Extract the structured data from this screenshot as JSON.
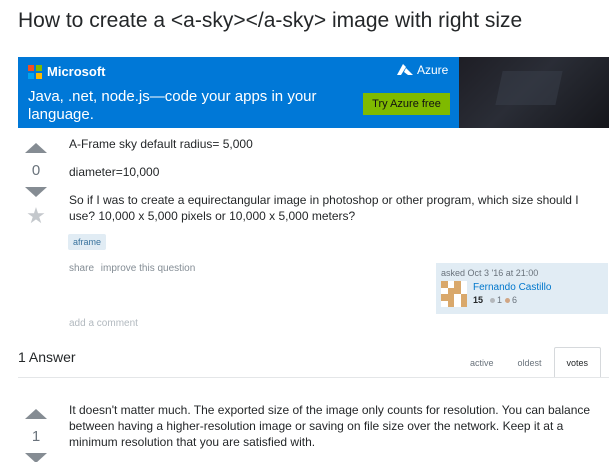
{
  "question": {
    "title": "How to create a <a-sky></a-sky> image with right size",
    "votes": "0",
    "body": [
      "A-Frame sky default radius= 5,000",
      "diameter=10,000",
      "So if I was to create a equirectangular image in photoshop or other program, which size should I use? 10,000 x 5,000 pixels or 10,000 x 5,000 meters?"
    ],
    "tag": "aframe",
    "share_label": "share",
    "improve_label": "improve this question",
    "add_comment_label": "add a comment",
    "asked": "asked Oct 3 '16 at 21:00",
    "user": {
      "name": "Fernando Castillo",
      "reputation": "15",
      "silver": "1",
      "bronze": "6"
    }
  },
  "ad": {
    "brand": "Microsoft",
    "tagline": "Java, .net, node.js—code your apps in your language.",
    "azure_label": "Azure",
    "cta": "Try Azure free",
    "colors": {
      "background": "#0078d7",
      "cta": "#7fba00"
    }
  },
  "answers": {
    "header": "1 Answer",
    "sort_tabs": [
      "active",
      "oldest",
      "votes"
    ],
    "selected_tab": "votes",
    "items": [
      {
        "votes": "1",
        "body": "It doesn't matter much. The exported size of the image only counts for resolution. You can balance between having a higher-resolution image or saving on file size over the network. Keep it at a minimum resolution that you are satisfied with."
      }
    ]
  },
  "colors": {
    "link": "#0077cc",
    "tag_bg": "#e1ecf4",
    "tag_text": "#39739d"
  }
}
